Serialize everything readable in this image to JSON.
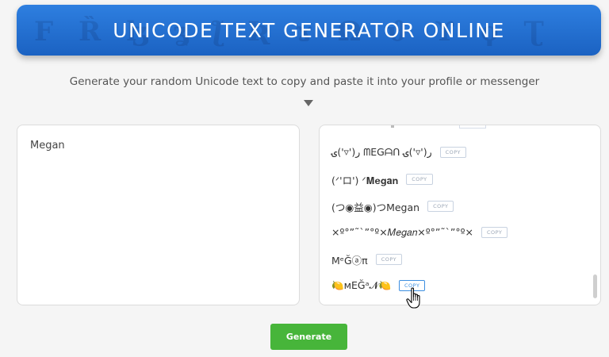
{
  "header": {
    "title": "UNICODE TEXT GENERATOR ONLINE",
    "background_glyphs": "F Ȑ ɮ ʓ ƪ Ʀ ɤ Ω ϑ ϒ ϙ Ʈ"
  },
  "subtitle": "Generate your random Unicode text to copy and paste it into your profile or messenger",
  "input": {
    "value": "Megan"
  },
  "results": [
    {
      "text": "ر('▿')ۍ ᗰEGᗩᑎ ر('▿')ۍ",
      "copy_label": "COPY"
    },
    {
      "text": "(ᐟ'ロ') ᐟ𝐌𝐞𝐠𝐚𝐧",
      "copy_label": "COPY"
    },
    {
      "text": "(つ◉益◉)つMegan",
      "copy_label": "COPY"
    },
    {
      "text": "×º°”˜`”°º×𝑀𝑒𝑔𝑎𝑛×º°”˜`”°º×",
      "copy_label": "COPY"
    },
    {
      "text": "MᵉĞⓐπ",
      "copy_label": "COPY"
    },
    {
      "text": "🍋ᴍEĞᵃ𝓝🍋",
      "copy_label": "COPY"
    }
  ],
  "generate_button": {
    "label": "Generate"
  },
  "colors": {
    "banner": "#1b62c2",
    "generate": "#47b53a",
    "copy_active": "#3d8fe0"
  }
}
